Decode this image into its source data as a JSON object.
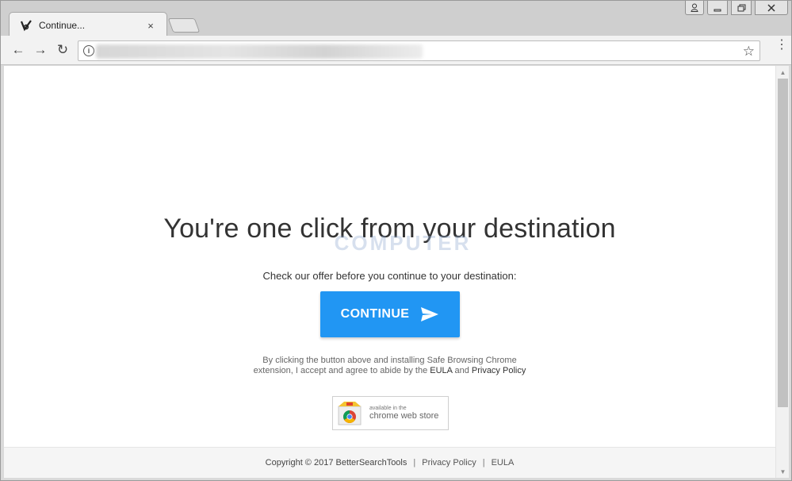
{
  "browser": {
    "tab": {
      "title": "Continue...",
      "close_glyph": "×",
      "favicon": "tick-logo-icon"
    },
    "window_controls": {
      "user": "user-icon",
      "minimize": "minimize-icon",
      "maximize": "maximize-icon",
      "close": "close-icon"
    },
    "toolbar": {
      "back": "←",
      "forward": "→",
      "reload": "↻",
      "info": "i",
      "star": "☆",
      "menu": "⋮"
    }
  },
  "page": {
    "headline": "You're one click from your destination",
    "watermark": "COMPUTER",
    "subline": "Check our offer before you continue to your destination:",
    "cta_label": "CONTINUE",
    "disclaimer_line1": "By clicking the button above and installing Safe Browsing Chrome",
    "disclaimer_line2_prefix": "extension, I accept and agree to abide by the ",
    "disclaimer_eula": "EULA",
    "disclaimer_and": " and ",
    "disclaimer_privacy": "Privacy Policy",
    "store_small": "available in the",
    "store_big": "chrome web store"
  },
  "footer": {
    "copyright": "Copyright © 2017 BetterSearchTools",
    "privacy": "Privacy Policy",
    "eula": "EULA",
    "separator": "|"
  },
  "colors": {
    "accent": "#2196f3",
    "footer_bg": "#f5f5f5"
  }
}
